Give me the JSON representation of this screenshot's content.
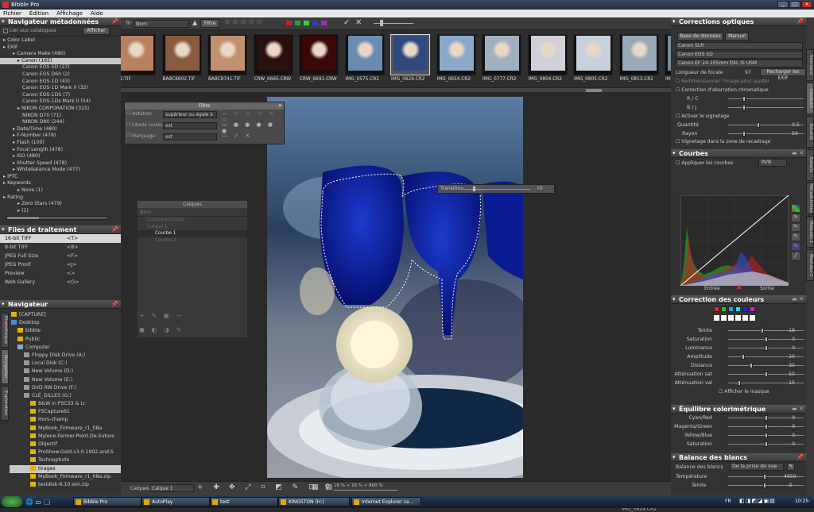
{
  "window": {
    "title": "Bibble Pro"
  },
  "menu": [
    "Fichier",
    "Édition",
    "Affichage",
    "Aide"
  ],
  "meta_nav": {
    "title": "Navigateur métadonnées",
    "filter_label": "Lier aux catalogues",
    "show_btn": "Afficher",
    "tree": [
      {
        "t": "Color Label",
        "i": 0
      },
      {
        "t": "EXIF",
        "i": 0
      },
      {
        "t": "Camera Make (480)",
        "i": 2
      },
      {
        "t": "Canon (165)",
        "i": 3,
        "sel": true
      },
      {
        "t": "Canon EOS 5D (27)",
        "i": 4
      },
      {
        "t": "Canon EOS D60 (2)",
        "i": 4
      },
      {
        "t": "Canon EOS-1D (43)",
        "i": 4
      },
      {
        "t": "Canon EOS-1D Mark II (32)",
        "i": 4
      },
      {
        "t": "Canon EOS-1DS (7)",
        "i": 4
      },
      {
        "t": "Canon EOS-1Ds Mark II (54)",
        "i": 4
      },
      {
        "t": "NIKON CORPORATION (315)",
        "i": 3
      },
      {
        "t": "NIKON D70 (71)",
        "i": 4
      },
      {
        "t": "NIKON D80 (244)",
        "i": 4
      },
      {
        "t": "Date/Time (480)",
        "i": 2
      },
      {
        "t": "F-Number (478)",
        "i": 2
      },
      {
        "t": "Flash (100)",
        "i": 2
      },
      {
        "t": "Focal Length (478)",
        "i": 2
      },
      {
        "t": "ISO (480)",
        "i": 2
      },
      {
        "t": "Shutter Speed (478)",
        "i": 2
      },
      {
        "t": "Whitebalance Mode (477)",
        "i": 2
      },
      {
        "t": "IPTC",
        "i": 0
      },
      {
        "t": "Keywords",
        "i": 0
      },
      {
        "t": "None (1)",
        "i": 3
      },
      {
        "t": "Rating",
        "i": 0
      },
      {
        "t": "Zero Stars (479)",
        "i": 3
      },
      {
        "t": "(1)",
        "i": 3
      }
    ]
  },
  "process_files": {
    "title": "Files de traitement",
    "items": [
      {
        "name": "16-bit TIFF",
        "key": "<T>",
        "sel": true
      },
      {
        "name": "8-bit TIFF",
        "key": "<8>"
      },
      {
        "name": "JPEG Full Size",
        "key": "<F>"
      },
      {
        "name": "JPEG Proof",
        "key": "<J>"
      },
      {
        "name": "Preview",
        "key": "<>"
      },
      {
        "name": "Web Gallery",
        "key": "<G>"
      }
    ]
  },
  "navigator": {
    "title": "Navigateur",
    "items": [
      {
        "t": "[CAPTURE]",
        "i": 0,
        "ic": "folder"
      },
      {
        "t": "Desktop",
        "i": 0,
        "ic": "desk"
      },
      {
        "t": "bibble",
        "i": 2,
        "ic": "folder"
      },
      {
        "t": "Public",
        "i": 2,
        "ic": "folder"
      },
      {
        "t": "Computer",
        "i": 2,
        "ic": "pc"
      },
      {
        "t": "Floppy Disk Drive (A:)",
        "i": 4,
        "ic": "drive"
      },
      {
        "t": "Local Disk (C:)",
        "i": 4,
        "ic": "drive"
      },
      {
        "t": "New Volume (D:)",
        "i": 4,
        "ic": "drive"
      },
      {
        "t": "New Volume (E:)",
        "i": 4,
        "ic": "drive"
      },
      {
        "t": "DVD RW Drive (F:)",
        "i": 4,
        "ic": "drive"
      },
      {
        "t": "CLÉ_GILLES (G:)",
        "i": 4,
        "ic": "drive"
      },
      {
        "t": "B&W in PSCS3 & Lr",
        "i": 6,
        "ic": "folder"
      },
      {
        "t": "FSCapture61",
        "i": 6,
        "ic": "folder"
      },
      {
        "t": "Hors-champ",
        "i": 6,
        "ic": "folder"
      },
      {
        "t": "MyBook_Firmware_r1_08a",
        "i": 6,
        "ic": "folder"
      },
      {
        "t": "Mylene.Farmer-Point.De.Suture",
        "i": 6,
        "ic": "folder"
      },
      {
        "t": "Objectif",
        "i": 6,
        "ic": "folder"
      },
      {
        "t": "ProShow.Gold.v3.0.1902.and.S",
        "i": 6,
        "ic": "folder"
      },
      {
        "t": "Technophoto",
        "i": 6,
        "ic": "folder"
      },
      {
        "t": "tirages",
        "i": 6,
        "ic": "folder",
        "sel": true
      },
      {
        "t": "MyBook_Firmware_r1_08a.zip",
        "i": 6,
        "ic": "folder"
      },
      {
        "t": "testdisk-6.10.win.zip",
        "i": 6,
        "ic": "folder"
      }
    ],
    "side_tabs": [
      "Photothèque",
      "Navigation",
      "Exploration"
    ]
  },
  "toolbar": {
    "sort_label": "Tri",
    "sort_value": "Nom",
    "filter_btn": "Filtre"
  },
  "thumbs": [
    {
      "cap": "22.TIF",
      "c": "#b98060"
    },
    {
      "cap": "BA8C8602.TIF",
      "c": "#8a5a40"
    },
    {
      "cap": "BA8C8741.TIF",
      "c": "#c09070"
    },
    {
      "cap": "CRW_6665.CRW",
      "c": "#2a1010"
    },
    {
      "cap": "CRW_6691.CRW",
      "c": "#3a0808"
    },
    {
      "cap": "IMG_0575.CR2",
      "c": "#6a8cb0"
    },
    {
      "cap": "IMG_0629.CR2",
      "c": "#304a80",
      "sel": true
    },
    {
      "cap": "IMG_0654.CR2",
      "c": "#8aa8c8"
    },
    {
      "cap": "IMG_0777.CR2",
      "c": "#a0b0c0"
    },
    {
      "cap": "IMG_0804.CR2",
      "c": "#d0d0d8"
    },
    {
      "cap": "IMG_0805.CR2",
      "c": "#c8d0dc"
    },
    {
      "cap": "IMG_0813.CR2",
      "c": "#9aa8b8"
    },
    {
      "cap": "IMG_0",
      "c": "#7a8a9a"
    }
  ],
  "filter_dialog": {
    "title": "Filtre",
    "rows": [
      {
        "label": "Notation",
        "op": "supérieur ou égale à"
      },
      {
        "label": "Libellé couleur",
        "op": "est"
      },
      {
        "label": "Marquage",
        "op": "est"
      }
    ]
  },
  "layers_panel": {
    "title": "Calques",
    "col": "Nom",
    "items": [
      "Calque principal",
      "Calque 1",
      "Courbe 1",
      "Courbe 2"
    ]
  },
  "transition": {
    "label": "Transition",
    "value": "70"
  },
  "bottom_bar": {
    "layers_label": "Calques",
    "layer_value": "Calque 1",
    "zoom": "16 % < 16 % < 800 %",
    "filename": "IMG_0629.CR2"
  },
  "optical": {
    "title": "Corrections optiques",
    "tabs": [
      "Base de données",
      "Manuel"
    ],
    "selects": [
      "Canon SLR",
      "Canon EOS 5D",
      "Canon EF 24-105mm f/4L IS USM"
    ],
    "focal_label": "Longueur de focale",
    "focal_value": "97",
    "reload_btn": "Recharger les EXIF",
    "redim_label": "Redimensionner l'image pour ajuster",
    "ca_label": "Correction d'aberration chromatique",
    "rc": "R / C",
    "bj": "B / J",
    "vignette_label": "Activer le vignetage",
    "qty_label": "Quantité",
    "qty_value": "0.5",
    "ray_label": "Rayon",
    "ray_value": "50",
    "vig_zone": "Vignetage dans la zone de recadrage"
  },
  "curves": {
    "title": "Courbes",
    "apply": "Appliquer les courbes",
    "channel": "RVB",
    "in": "Entrée",
    "out": "Sortie"
  },
  "color_corr": {
    "title": "Correction des couleurs",
    "swatches": [
      "#ff2020",
      "#20c020",
      "#20a0ff",
      "#20e0e0",
      "#2020ff",
      "#e020e0"
    ],
    "sliders": [
      {
        "l": "Teinte",
        "v": "-16",
        "p": 0.45
      },
      {
        "l": "Saturation",
        "v": "0",
        "p": 0.5
      },
      {
        "l": "Luminance",
        "v": "0",
        "p": 0.5
      },
      {
        "l": "Amplitude",
        "v": "20",
        "p": 0.2
      },
      {
        "l": "Distance",
        "v": "30",
        "p": 0.3
      },
      {
        "l": "Atténuation sat",
        "v": "50",
        "p": 0.5
      },
      {
        "l": "Atténuation val",
        "v": "15",
        "p": 0.15
      }
    ],
    "mask": "Afficher le masque"
  },
  "balance": {
    "title": "Équilibre colorimétrique",
    "sliders": [
      {
        "l": "Cyan/Red",
        "v": "0"
      },
      {
        "l": "Magenta/Green",
        "v": "0"
      },
      {
        "l": "Yellow/Blue",
        "v": "0"
      },
      {
        "l": "Saturation",
        "v": "0"
      }
    ]
  },
  "whitebal": {
    "title": "Balance des blancs",
    "label": "Balance des blancs",
    "value": "De la prise de vue",
    "temp_l": "Température",
    "temp_v": "4950",
    "tint_l": "Teinte",
    "tint_v": "-3"
  },
  "right_tabs": [
    "Standard",
    "Couleurs",
    "Tonalité",
    "Détails",
    "Métadonnées",
    "Modules-1",
    "Modules-2"
  ],
  "taskbar": {
    "items": [
      "Bibble Pro",
      "AutoPlay",
      "test",
      "KINGSTON (H:)",
      "Internet Explorer ca..."
    ],
    "lang": "FR",
    "clock": "10:25"
  }
}
